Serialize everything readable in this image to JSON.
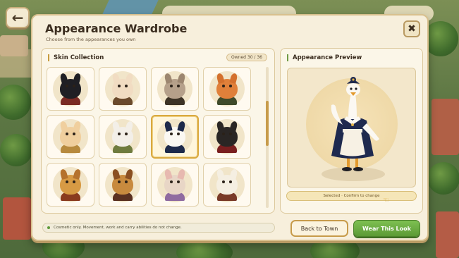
{
  "window": {
    "title": "Appearance Wardrobe",
    "subtitle": "Choose from the appearances you own"
  },
  "top_bar": {
    "center_text": ""
  },
  "collection": {
    "title": "Skin Collection",
    "owned": "Owned 30 / 36",
    "scroll_position": 0.35,
    "skins": [
      {
        "name": "black-panther",
        "icon": "panther-icon",
        "face": "#1f1f24",
        "ear": "#1f1f24",
        "outfit": "#7a2a24"
      },
      {
        "name": "bunny",
        "icon": "bunny-icon",
        "face": "#f1dcc2",
        "ear": "#f1dcc2",
        "outfit": "#6b4a2c"
      },
      {
        "name": "tabby-cat",
        "icon": "cat-icon",
        "face": "#b5a08a",
        "ear": "#9c8670",
        "outfit": "#3d3326"
      },
      {
        "name": "fox",
        "icon": "fox-icon",
        "face": "#e0803a",
        "ear": "#d4702d",
        "outfit": "#3f4a2a"
      },
      {
        "name": "fennec",
        "icon": "fennec-icon",
        "face": "#f0cf9e",
        "ear": "#f0cf9e",
        "outfit": "#b78a3e"
      },
      {
        "name": "white-rabbit",
        "icon": "rabbit-icon",
        "face": "#f3efe8",
        "ear": "#f3efe8",
        "outfit": "#6f7b3e"
      },
      {
        "name": "goose",
        "icon": "goose-icon",
        "face": "#fbf8f2",
        "ear": "#1e2a4a",
        "outfit": "#1e2a4a",
        "selected": true
      },
      {
        "name": "gorilla",
        "icon": "gorilla-icon",
        "face": "#2a2624",
        "ear": "#2a2624",
        "outfit": "#7a1f1f"
      },
      {
        "name": "lion-cub",
        "icon": "lion-icon",
        "face": "#d79a44",
        "ear": "#b5722d",
        "outfit": "#8a3b1e"
      },
      {
        "name": "lion",
        "icon": "lion-icon",
        "face": "#c88a3e",
        "ear": "#8a4f22",
        "outfit": "#5a3020"
      },
      {
        "name": "mouse",
        "icon": "mouse-icon",
        "face": "#e8d6c6",
        "ear": "#e7b9b0",
        "outfit": "#8f6ba0"
      },
      {
        "name": "polar-bear",
        "icon": "bear-icon",
        "face": "#f5efe2",
        "ear": "#f5efe2",
        "outfit": "#7a3a28"
      }
    ]
  },
  "preview": {
    "title": "Appearance Preview",
    "status": "Selected · Confirm to change",
    "character_icon": "goose-maid-icon",
    "colors": {
      "dress": "#1f2a4f",
      "apron": "#f7f1e4",
      "neck": "#fbf8f2",
      "beak": "#e39a2d"
    }
  },
  "footer": {
    "note": "Cosmetic only. Movement, work and carry abilities do not change.",
    "back_label": "Back to Town",
    "wear_label": "Wear This Look"
  },
  "colors": {
    "accent": "#c79b4a",
    "confirm": "#6aae40",
    "panel": "#f7efdc"
  }
}
